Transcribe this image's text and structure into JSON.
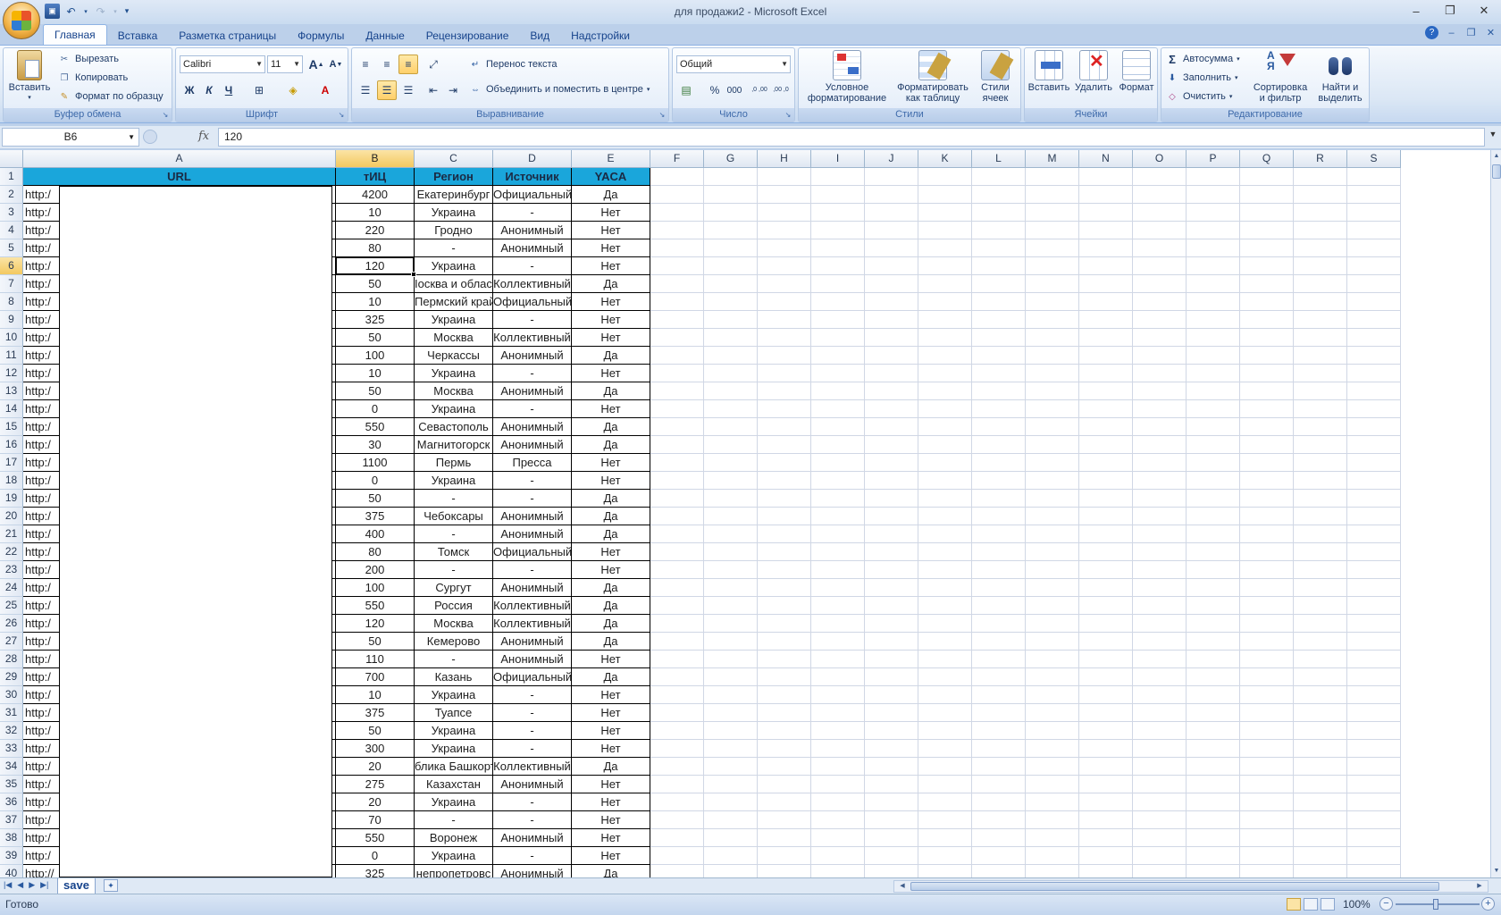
{
  "app": {
    "window_title": "для продажи2 - Microsoft Excel",
    "window_controls": [
      "–",
      "❐",
      "✕"
    ],
    "workbook_controls": [
      "–",
      "❐",
      "✕"
    ]
  },
  "quick_access": {
    "undo_icon": "↶",
    "redo_icon": "↷",
    "customize_icon": "▾"
  },
  "ribbon_tabs": [
    "Главная",
    "Вставка",
    "Разметка страницы",
    "Формулы",
    "Данные",
    "Рецензирование",
    "Вид",
    "Надстройки"
  ],
  "ribbon": {
    "clipboard": {
      "label": "Буфер обмена",
      "paste": "Вставить",
      "cut": "Вырезать",
      "copy": "Копировать",
      "format_painter": "Формат по образцу"
    },
    "font": {
      "label": "Шрифт",
      "font_name": "Calibri",
      "font_size": "11",
      "bold": "Ж",
      "italic": "К",
      "underline": "Ч",
      "grow": "A",
      "shrink": "A"
    },
    "alignment": {
      "label": "Выравнивание",
      "wrap_text": "Перенос текста",
      "merge_center": "Объединить и поместить в центре"
    },
    "number": {
      "label": "Число",
      "format": "Общий",
      "percent": "%",
      "thousands": "000",
      "inc_decimal": ",0 ,00",
      "dec_decimal": ",00 ,0"
    },
    "styles": {
      "label": "Стили",
      "conditional": [
        "Условное",
        "форматирование"
      ],
      "format_table": [
        "Форматировать",
        "как таблицу"
      ],
      "cell_styles": [
        "Стили",
        "ячеек"
      ]
    },
    "cells": {
      "label": "Ячейки",
      "insert": "Вставить",
      "delete": "Удалить",
      "format": "Формат"
    },
    "editing": {
      "label": "Редактирование",
      "autosum": "Автосумма",
      "fill": "Заполнить",
      "clear": "Очистить",
      "sort": [
        "Сортировка",
        "и фильтр"
      ],
      "find": [
        "Найти и",
        "выделить"
      ]
    }
  },
  "formula_bar": {
    "name_box": "B6",
    "fx": "fx",
    "content": "120"
  },
  "columns": [
    "A",
    "B",
    "C",
    "D",
    "E",
    "F",
    "G",
    "H",
    "I",
    "J",
    "K",
    "L",
    "M",
    "N",
    "O",
    "P",
    "Q",
    "R",
    "S"
  ],
  "table_header": {
    "url": "URL",
    "tic": "тИЦ",
    "region": "Регион",
    "source": "Источник",
    "yaca": "YACA"
  },
  "rows": [
    {
      "n": "2",
      "a": "http:/",
      "b": "4200",
      "c": "Екатеринбург",
      "d": "Официальный",
      "e": "Да"
    },
    {
      "n": "3",
      "a": "http:/",
      "b": "10",
      "c": "Украина",
      "d": "-",
      "e": "Нет"
    },
    {
      "n": "4",
      "a": "http:/",
      "b": "220",
      "c": "Гродно",
      "d": "Анонимный",
      "e": "Нет"
    },
    {
      "n": "5",
      "a": "http:/",
      "b": "80",
      "c": "-",
      "d": "Анонимный",
      "e": "Нет"
    },
    {
      "n": "6",
      "a": "http:/",
      "b": "120",
      "c": "Украина",
      "d": "-",
      "e": "Нет"
    },
    {
      "n": "7",
      "a": "http:/",
      "b": "50",
      "c": "Іосква и област",
      "d": "Коллективный",
      "e": "Да"
    },
    {
      "n": "8",
      "a": "http:/",
      "b": "10",
      "c": "Пермский край",
      "d": "Официальный",
      "e": "Нет"
    },
    {
      "n": "9",
      "a": "http:/",
      "b": "325",
      "c": "Украина",
      "d": "-",
      "e": "Нет"
    },
    {
      "n": "10",
      "a": "http:/",
      "b": "50",
      "c": "Москва",
      "d": "Коллективный",
      "e": "Нет"
    },
    {
      "n": "11",
      "a": "http:/",
      "b": "100",
      "c": "Черкассы",
      "d": "Анонимный",
      "e": "Да"
    },
    {
      "n": "12",
      "a": "http:/",
      "b": "10",
      "c": "Украина",
      "d": "-",
      "e": "Нет"
    },
    {
      "n": "13",
      "a": "http:/",
      "b": "50",
      "c": "Москва",
      "d": "Анонимный",
      "e": "Да"
    },
    {
      "n": "14",
      "a": "http:/",
      "b": "0",
      "c": "Украина",
      "d": "-",
      "e": "Нет"
    },
    {
      "n": "15",
      "a": "http:/",
      "b": "550",
      "c": "Севастополь",
      "d": "Анонимный",
      "e": "Да"
    },
    {
      "n": "16",
      "a": "http:/",
      "b": "30",
      "c": "Магнитогорск",
      "d": "Анонимный",
      "e": "Да"
    },
    {
      "n": "17",
      "a": "http:/",
      "b": "1100",
      "c": "Пермь",
      "d": "Пресса",
      "e": "Нет"
    },
    {
      "n": "18",
      "a": "http:/",
      "b": "0",
      "c": "Украина",
      "d": "-",
      "e": "Нет"
    },
    {
      "n": "19",
      "a": "http:/",
      "b": "50",
      "c": "-",
      "d": "-",
      "e": "Да"
    },
    {
      "n": "20",
      "a": "http:/",
      "b": "375",
      "c": "Чебоксары",
      "d": "Анонимный",
      "e": "Да"
    },
    {
      "n": "21",
      "a": "http:/",
      "b": "400",
      "c": "-",
      "d": "Анонимный",
      "e": "Да"
    },
    {
      "n": "22",
      "a": "http:/",
      "b": "80",
      "c": "Томск",
      "d": "Официальный",
      "e": "Нет"
    },
    {
      "n": "23",
      "a": "http:/",
      "b": "200",
      "c": "-",
      "d": "-",
      "e": "Нет"
    },
    {
      "n": "24",
      "a": "http:/",
      "b": "100",
      "c": "Сургут",
      "d": "Анонимный",
      "e": "Да"
    },
    {
      "n": "25",
      "a": "http:/",
      "b": "550",
      "c": "Россия",
      "d": "Коллективный",
      "e": "Да"
    },
    {
      "n": "26",
      "a": "http:/",
      "b": "120",
      "c": "Москва",
      "d": "Коллективный",
      "e": "Да"
    },
    {
      "n": "27",
      "a": "http:/",
      "b": "50",
      "c": "Кемерово",
      "d": "Анонимный",
      "e": "Да"
    },
    {
      "n": "28",
      "a": "http:/",
      "b": "110",
      "c": "-",
      "d": "Анонимный",
      "e": "Нет"
    },
    {
      "n": "29",
      "a": "http:/",
      "b": "700",
      "c": "Казань",
      "d": "Официальный",
      "e": "Да"
    },
    {
      "n": "30",
      "a": "http:/",
      "b": "10",
      "c": "Украина",
      "d": "-",
      "e": "Нет"
    },
    {
      "n": "31",
      "a": "http:/",
      "b": "375",
      "c": "Туапсе",
      "d": "-",
      "e": "Нет"
    },
    {
      "n": "32",
      "a": "http:/",
      "b": "50",
      "c": "Украина",
      "d": "-",
      "e": "Нет"
    },
    {
      "n": "33",
      "a": "http:/",
      "b": "300",
      "c": "Украина",
      "d": "-",
      "e": "Нет"
    },
    {
      "n": "34",
      "a": "http:/",
      "b": "20",
      "c": "блика Башкорт",
      "d": "Коллективный",
      "e": "Да"
    },
    {
      "n": "35",
      "a": "http:/",
      "b": "275",
      "c": "Казахстан",
      "d": "Анонимный",
      "e": "Нет"
    },
    {
      "n": "36",
      "a": "http:/",
      "b": "20",
      "c": "Украина",
      "d": "-",
      "e": "Нет"
    },
    {
      "n": "37",
      "a": "http:/",
      "b": "70",
      "c": "-",
      "d": "-",
      "e": "Нет"
    },
    {
      "n": "38",
      "a": "http:/",
      "b": "550",
      "c": "Воронеж",
      "d": "Анонимный",
      "e": "Нет"
    },
    {
      "n": "39",
      "a": "http:/",
      "b": "0",
      "c": "Украина",
      "d": "-",
      "e": "Нет"
    },
    {
      "n": "40",
      "a": "http://",
      "b": "325",
      "c": "непропетровс",
      "d": "Анонимный",
      "e": "Да"
    }
  ],
  "header_row_number": "1",
  "active_cell": "B6",
  "sheet": {
    "tab": "save"
  },
  "status": {
    "ready": "Готово",
    "zoom": "100%"
  },
  "colors": {
    "header_fill": "#1aa6db",
    "selection": "#f3c960"
  }
}
